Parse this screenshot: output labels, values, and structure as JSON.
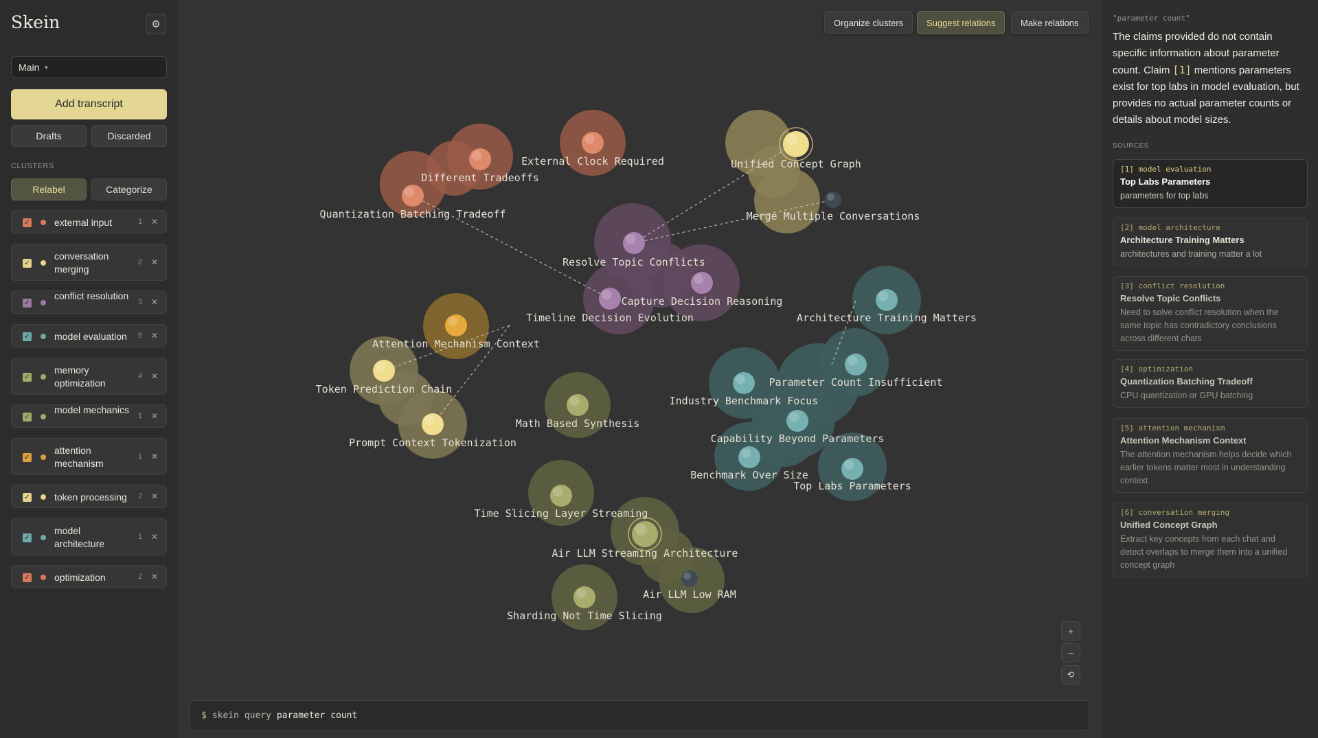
{
  "app": {
    "title": "Skein",
    "settings_icon": "gear-icon"
  },
  "sidebar": {
    "view_select": "Main",
    "add_transcript": "Add transcript",
    "drafts": "Drafts",
    "discarded": "Discarded",
    "clusters_heading": "CLUSTERS",
    "relabel": "Relabel",
    "categorize": "Categorize",
    "clusters": [
      {
        "name": "external input",
        "count": "1",
        "color": "#d97a5e",
        "checked": true
      },
      {
        "name": "conversation merging",
        "count": "2",
        "color": "#e6d28a",
        "checked": true
      },
      {
        "name": "conflict resolution",
        "count": "3",
        "color": "#9a7aa3",
        "checked": true
      },
      {
        "name": "model evaluation",
        "count": "5",
        "color": "#6fa7a7",
        "checked": true
      },
      {
        "name": "memory optimization",
        "count": "4",
        "color": "#a3a96a",
        "checked": true
      },
      {
        "name": "model mechanics",
        "count": "1",
        "color": "#a3a96a",
        "checked": true
      },
      {
        "name": "attention mechanism",
        "count": "1",
        "color": "#d9a23f",
        "checked": true
      },
      {
        "name": "token processing",
        "count": "2",
        "color": "#e6d28a",
        "checked": true
      },
      {
        "name": "model architecture",
        "count": "1",
        "color": "#6fa7a7",
        "checked": true
      },
      {
        "name": "optimization",
        "count": "2",
        "color": "#d97a5e",
        "checked": true
      }
    ]
  },
  "toolbar": {
    "organize": "Organize clusters",
    "suggest": "Suggest relations",
    "make": "Make relations"
  },
  "zoom": {
    "in": "+",
    "out": "−",
    "reset": "⟲"
  },
  "query": {
    "prompt": "$",
    "command": "skein query",
    "text": "parameter count"
  },
  "graph": {
    "nodes": [
      {
        "id": "dt",
        "label": "Different Tradeoffs",
        "color": "#e08a6c"
      },
      {
        "id": "qbt",
        "label": "Quantization Batching Tradeoff",
        "color": "#e08a6c"
      },
      {
        "id": "ecr",
        "label": "External Clock Required",
        "color": "#e08a6c"
      },
      {
        "id": "ucg",
        "label": "Unified Concept Graph",
        "color": "#f0de8e"
      },
      {
        "id": "mmc",
        "label": "Merge Multiple Conversations",
        "color": "#3e4a55"
      },
      {
        "id": "rtc",
        "label": "Resolve Topic Conflicts",
        "color": "#a682ad"
      },
      {
        "id": "cdr",
        "label": "Capture Decision Reasoning",
        "color": "#a682ad"
      },
      {
        "id": "tde",
        "label": "Timeline Decision Evolution",
        "color": "#a682ad"
      },
      {
        "id": "amc",
        "label": "Attention Mechanism Context",
        "color": "#e5a93e"
      },
      {
        "id": "tpc",
        "label": "Token Prediction Chain",
        "color": "#f0de8e"
      },
      {
        "id": "pct",
        "label": "Prompt Context Tokenization",
        "color": "#f0de8e"
      },
      {
        "id": "mbs",
        "label": "Math Based Synthesis",
        "color": "#a8ad6e"
      },
      {
        "id": "atm",
        "label": "Architecture Training Matters",
        "color": "#76b0b0"
      },
      {
        "id": "pci",
        "label": "Parameter Count Insufficient",
        "color": "#76b0b0"
      },
      {
        "id": "ibf",
        "label": "Industry Benchmark Focus",
        "color": "#76b0b0"
      },
      {
        "id": "cbp",
        "label": "Capability Beyond Parameters",
        "color": "#76b0b0"
      },
      {
        "id": "bos",
        "label": "Benchmark Over Size",
        "color": "#76b0b0"
      },
      {
        "id": "tlp",
        "label": "Top Labs Parameters",
        "color": "#76b0b0"
      },
      {
        "id": "tsls",
        "label": "Time Slicing Layer Streaming",
        "color": "#a8ad6e"
      },
      {
        "id": "alsa",
        "label": "Air LLM Streaming Architecture",
        "color": "#a8ad6e"
      },
      {
        "id": "alr",
        "label": "Air LLM Low RAM",
        "color": "#3e4a55"
      },
      {
        "id": "snts",
        "label": "Sharding Not Time Slicing",
        "color": "#a8ad6e"
      }
    ]
  },
  "panel": {
    "query_echo": "\"parameter count\"",
    "answer_before": "The claims provided do not contain specific information about parameter count. Claim ",
    "answer_cite": "[1]",
    "answer_after": " mentions parameters exist for top labs in model evaluation, but provides no actual parameter counts or details about model sizes.",
    "sources_heading": "SOURCES",
    "sources": [
      {
        "tag": "[1] model evaluation",
        "title": "Top Labs Parameters",
        "body": "parameters for top labs"
      },
      {
        "tag": "[2] model architecture",
        "title": "Architecture Training Matters",
        "body": "architectures and training matter a lot"
      },
      {
        "tag": "[3] conflict resolution",
        "title": "Resolve Topic Conflicts",
        "body": "Need to solve conflict resolution when the same topic has contradictory conclusions across different chats"
      },
      {
        "tag": "[4] optimization",
        "title": "Quantization Batching Tradeoff",
        "body": "CPU quantization or GPU batching"
      },
      {
        "tag": "[5] attention mechanism",
        "title": "Attention Mechanism Context",
        "body": "The attention mechanism helps decide which earlier tokens matter most in understanding context"
      },
      {
        "tag": "[6] conversation merging",
        "title": "Unified Concept Graph",
        "body": "Extract key concepts from each chat and detect overlaps to merge them into a unified concept graph"
      }
    ]
  }
}
